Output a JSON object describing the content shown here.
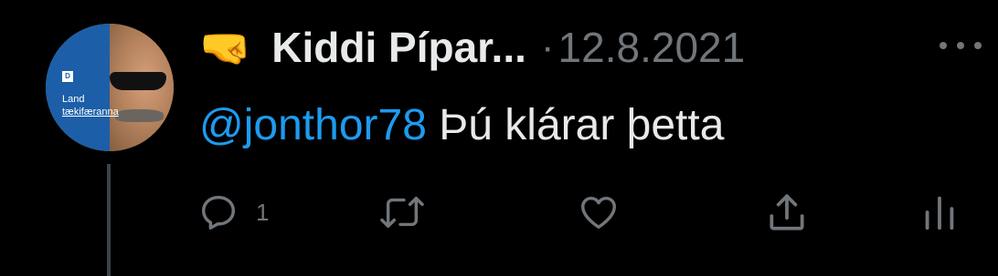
{
  "colors": {
    "background": "#000000",
    "name": "#e7e9ea",
    "muted": "#71767b",
    "mention": "#1d9bf0",
    "avatar_panel": "#1c5fa8"
  },
  "avatar": {
    "badge_letter": "D",
    "text_line1": "Land",
    "text_line2": "tækifæranna"
  },
  "header": {
    "emoji": "🤜",
    "display_name": "Kiddi Pípar...",
    "separator": "·",
    "date": "12.8.2021",
    "more_icon": "more-horizontal-icon"
  },
  "tweet": {
    "mention": "@jonthor78",
    "text": " Þú klárar þetta"
  },
  "actions": {
    "reply": {
      "icon": "reply-icon",
      "count": "1"
    },
    "retweet": {
      "icon": "retweet-icon"
    },
    "like": {
      "icon": "heart-icon"
    },
    "share": {
      "icon": "share-icon"
    },
    "analytics": {
      "icon": "analytics-icon"
    }
  }
}
